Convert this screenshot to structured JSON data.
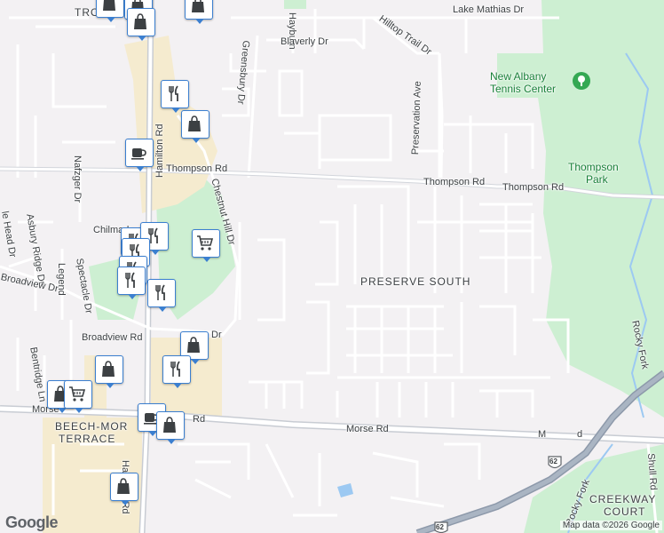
{
  "map": {
    "roads": {
      "hilltop": "Hilltop Trail Dr",
      "lake_mathias": "Lake Mathias Dr",
      "hayburn": "Hayburn",
      "blaverly": "Blaverly Dr",
      "greensbury": "Greensbury Dr",
      "preservation": "Preservation Ave",
      "thompson_left": "Thompson Rd",
      "thompson_mid": "Thompson Rd",
      "thompson_right": "Thompson Rd",
      "hamilton_top": "Hamilton Rd",
      "hamilton_bottom": "Hamilton Rd",
      "chestnut_hill": "Chestnut Hill Dr",
      "nafzger": "Nafzger Dr",
      "asbury_ridge": "Asbury Ridge Dr",
      "head_dr": "le Head Dr",
      "chilmark": "Chilmark",
      "broadview_left": "Broadview Dr",
      "legend": "Legend",
      "spectacle": "Spectacle Dr",
      "broadview_rd": "Broadview Rd",
      "dr_fragment": "Dr",
      "bentridge": "Bentridge Ln",
      "morse_left": "Morse",
      "morse_mid_rd": "Rd",
      "morse_center": "Morse Rd",
      "morse_right_a": "M",
      "morse_right_b": "d",
      "rocky_fork_right": "Rocky Fork",
      "rocky_fork_bottom": "Rocky Fork",
      "shull": "Shull Rd",
      "tro": "TRO"
    },
    "areas": {
      "preserve_south": "PRESERVE SOUTH",
      "beech_mor_1": "BEECH-MOR",
      "beech_mor_2": "TERRACE",
      "creekway_1": "CREEKWAY",
      "creekway_2": "COURT"
    },
    "parks": {
      "tennis_1": "New Albany",
      "tennis_2": "Tennis Center",
      "thompson_1": "Thompson",
      "thompson_2": "Park"
    },
    "route_shield": "62",
    "route_shield_2": "62",
    "logo": "Google",
    "attribution": "Map data ©2026 Google",
    "colors": {
      "background": "#f3f1f3",
      "park": "#cdefd2",
      "commercial": "#f5ebcf",
      "major_road": "#c8ccd3",
      "highway": "#8d99aa",
      "water": "#9cc9f2",
      "pin_border": "#3b7fd0"
    }
  },
  "pins": [
    {
      "icon": "shopping-bag-icon",
      "label": "shopping"
    },
    {
      "icon": "shopping-bag-icon",
      "label": "shopping"
    },
    {
      "icon": "shopping-bag-icon",
      "label": "shopping"
    },
    {
      "icon": "restaurant-icon",
      "label": "restaurant"
    },
    {
      "icon": "shopping-bag-icon",
      "label": "shopping"
    },
    {
      "icon": "cafe-icon",
      "label": "cafe"
    },
    {
      "icon": "restaurant-icon",
      "label": "restaurant"
    },
    {
      "icon": "grocery-cart-icon",
      "label": "grocery"
    },
    {
      "icon": "restaurant-icon",
      "label": "restaurant"
    },
    {
      "icon": "restaurant-icon",
      "label": "restaurant"
    },
    {
      "icon": "restaurant-icon",
      "label": "restaurant"
    },
    {
      "icon": "restaurant-icon",
      "label": "restaurant"
    },
    {
      "icon": "restaurant-icon",
      "label": "restaurant"
    },
    {
      "icon": "shopping-bag-icon",
      "label": "shopping"
    },
    {
      "icon": "restaurant-icon",
      "label": "restaurant"
    },
    {
      "icon": "shopping-bag-icon",
      "label": "shopping"
    },
    {
      "icon": "shopping-bag-icon",
      "label": "shopping"
    },
    {
      "icon": "grocery-cart-icon",
      "label": "grocery"
    },
    {
      "icon": "cafe-icon",
      "label": "cafe"
    },
    {
      "icon": "shopping-bag-icon",
      "label": "shopping"
    },
    {
      "icon": "shopping-bag-icon",
      "label": "shopping"
    },
    {
      "icon": "shopping-bag-icon",
      "label": "shopping"
    }
  ]
}
